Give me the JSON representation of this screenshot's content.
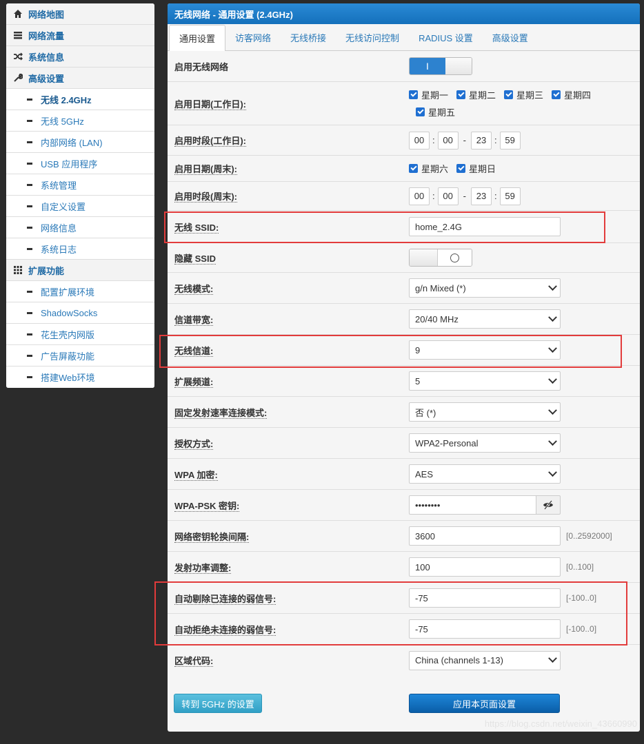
{
  "sidebar": {
    "items": [
      {
        "label": "网络地图",
        "kind": "top",
        "icon": "home-icon"
      },
      {
        "label": "网络流量",
        "kind": "top",
        "icon": "list-icon"
      },
      {
        "label": "系统信息",
        "kind": "top",
        "icon": "shuffle-icon"
      },
      {
        "label": "高级设置",
        "kind": "top",
        "icon": "wrench-icon"
      },
      {
        "label": "无线 2.4GHz",
        "kind": "sub",
        "active": true
      },
      {
        "label": "无线 5GHz",
        "kind": "sub"
      },
      {
        "label": "内部网络 (LAN)",
        "kind": "sub"
      },
      {
        "label": "USB 应用程序",
        "kind": "sub"
      },
      {
        "label": "系统管理",
        "kind": "sub"
      },
      {
        "label": "自定义设置",
        "kind": "sub"
      },
      {
        "label": "网络信息",
        "kind": "sub"
      },
      {
        "label": "系统日志",
        "kind": "sub"
      },
      {
        "label": "扩展功能",
        "kind": "top",
        "icon": "grid-icon"
      },
      {
        "label": "配置扩展环境",
        "kind": "sub"
      },
      {
        "label": "ShadowSocks",
        "kind": "sub"
      },
      {
        "label": "花生壳内网版",
        "kind": "sub"
      },
      {
        "label": "广告屏蔽功能",
        "kind": "sub"
      },
      {
        "label": "搭建Web环境",
        "kind": "sub"
      }
    ]
  },
  "panel": {
    "title": "无线网络 - 通用设置 (2.4GHz)",
    "tabs": [
      "通用设置",
      "访客网络",
      "无线桥接",
      "无线访问控制",
      "RADIUS 设置",
      "高级设置"
    ]
  },
  "form": {
    "enable_wireless": {
      "label": "启用无线网络",
      "on_text": "I"
    },
    "workday_dates": {
      "label": "启用日期(工作日):",
      "days": [
        "星期一",
        "星期二",
        "星期三",
        "星期四",
        "星期五"
      ]
    },
    "workday_time": {
      "label": "启用时段(工作日):",
      "h1": "00",
      "m1": "00",
      "h2": "23",
      "m2": "59",
      "sep": ":",
      "dash": "-"
    },
    "weekend_dates": {
      "label": "启用日期(周末):",
      "days": [
        "星期六",
        "星期日"
      ]
    },
    "weekend_time": {
      "label": "启用时段(周末):",
      "h1": "00",
      "m1": "00",
      "h2": "23",
      "m2": "59",
      "sep": ":",
      "dash": "-"
    },
    "ssid": {
      "label": "无线 SSID:",
      "value": "home_2.4G"
    },
    "hide_ssid": {
      "label": "隐藏 SSID"
    },
    "mode": {
      "label": "无线模式:",
      "value": "g/n Mixed (*)"
    },
    "bandwidth": {
      "label": "信道带宽:",
      "value": "20/40 MHz"
    },
    "channel": {
      "label": "无线信道:",
      "value": "9"
    },
    "ext_channel": {
      "label": "扩展频道:",
      "value": "5"
    },
    "fixed_rate": {
      "label": "固定发射速率连接模式:",
      "value": "否 (*)"
    },
    "auth": {
      "label": "授权方式:",
      "value": "WPA2-Personal"
    },
    "wpa_enc": {
      "label": "WPA 加密:",
      "value": "AES"
    },
    "psk": {
      "label": "WPA-PSK 密钥:",
      "value": "••••••••"
    },
    "rekey": {
      "label": "网络密钥轮换间隔:",
      "value": "3600",
      "hint": "[0..2592000]"
    },
    "txpower": {
      "label": "发射功率调整:",
      "value": "100",
      "hint": "[0..100]"
    },
    "kick_weak": {
      "label": "自动剔除已连接的弱信号:",
      "value": "-75",
      "hint": "[-100..0]"
    },
    "reject_weak": {
      "label": "自动拒绝未连接的弱信号:",
      "value": "-75",
      "hint": "[-100..0]"
    },
    "region": {
      "label": "区域代码:",
      "value": "China (channels 1-13)"
    }
  },
  "buttons": {
    "goto5g": "转到 5GHz 的设置",
    "apply": "应用本页面设置"
  },
  "watermark": "https://blog.csdn.net/weixin_43660990",
  "colors": {
    "accent": "#1b7cc8",
    "highlight": "#e23b3b",
    "background": "#2b2b2b"
  }
}
